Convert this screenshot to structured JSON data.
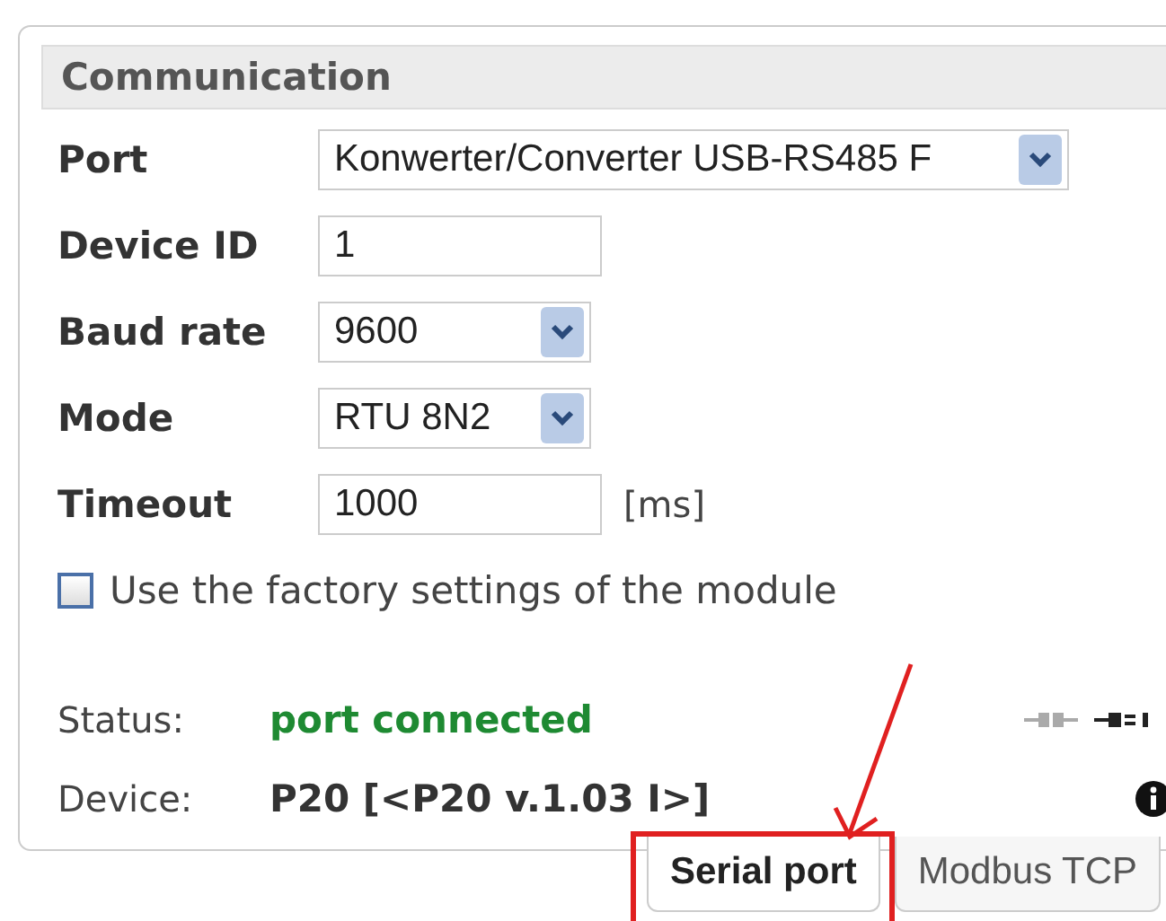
{
  "panel": {
    "title": "Communication"
  },
  "fields": [
    {
      "kind": "wide-select",
      "label": "Port",
      "value": "Konwerter/Converter USB-RS485 F"
    },
    {
      "kind": "text",
      "label": "Device ID",
      "value": "1"
    },
    {
      "kind": "select",
      "label": "Baud rate",
      "value": "9600"
    },
    {
      "kind": "select",
      "label": "Mode",
      "value": "RTU 8N2"
    },
    {
      "kind": "text",
      "label": "Timeout",
      "value": "1000",
      "unit": "[ms]"
    }
  ],
  "factory_settings": {
    "label": "Use the factory settings of the module",
    "checked": false
  },
  "status": {
    "label": "Status:",
    "value": "port connected"
  },
  "device": {
    "label": "Device:",
    "value": "P20 [<P20 v.1.03 I>]"
  },
  "tabs": [
    {
      "label": "Serial port",
      "selected": true
    },
    {
      "label": "Modbus TCP",
      "selected": false
    }
  ]
}
